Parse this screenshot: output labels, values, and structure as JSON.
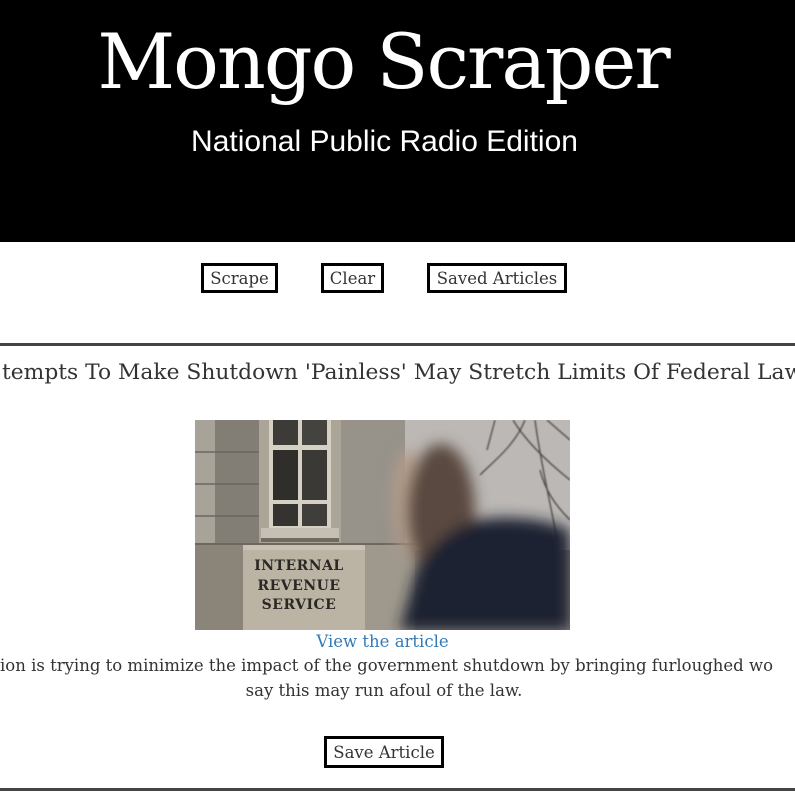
{
  "header": {
    "title": "Mongo Scraper",
    "subtitle": "National Public Radio Edition"
  },
  "toolbar": {
    "scrape_label": "Scrape",
    "clear_label": "Clear",
    "saved_articles_label": "Saved Articles"
  },
  "articles": [
    {
      "headline": "tempts To Make Shutdown 'Painless' May Stretch Limits Of Federal Law",
      "image": {
        "sign_text": [
          "INTERNAL",
          "REVENUE",
          "SERVICE"
        ]
      },
      "link_label": "View the article",
      "summary_lines": [
        "ion is trying to minimize the impact of the government shutdown by bringing furloughed wo",
        "say this may run afoul of the law."
      ],
      "save_label": "Save Article"
    }
  ],
  "colors": {
    "header_background": "#000000",
    "header_text": "#ffffff",
    "body_text": "#333333",
    "link": "#337ab7",
    "button_border": "#000000",
    "divider": "#444444"
  }
}
